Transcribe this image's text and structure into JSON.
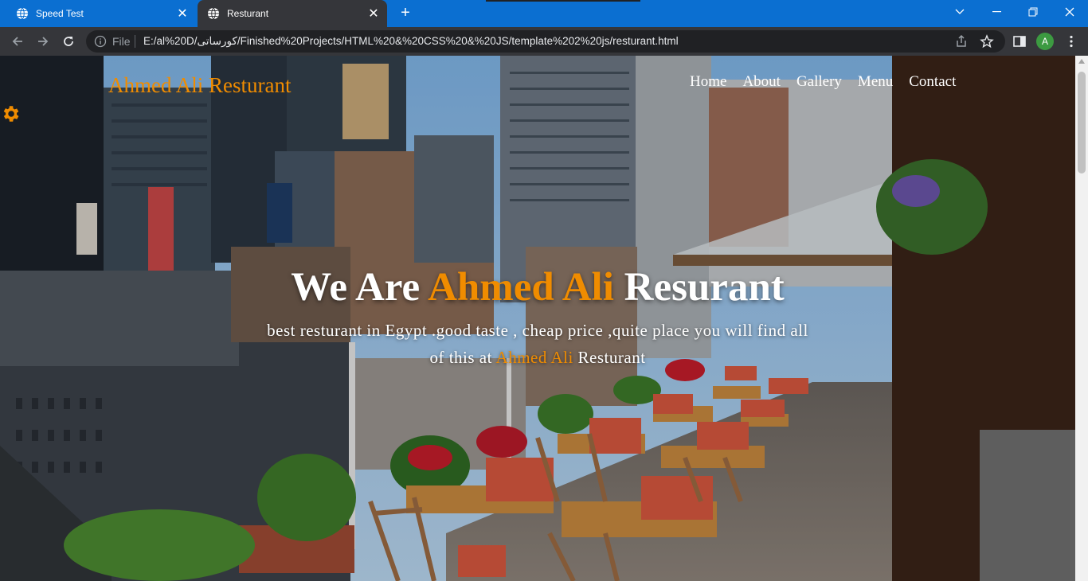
{
  "browser": {
    "tabs": [
      {
        "title": "Speed Test",
        "active": false
      },
      {
        "title": "Resturant",
        "active": true
      }
    ],
    "new_tab_label": "+",
    "window_controls": {
      "minimize": "—",
      "restore": "❐",
      "close": "✕"
    },
    "address": {
      "scheme_label": "File",
      "url": "E:/al%20D/کورساتی/Finished%20Projects/HTML%20&%20CSS%20&%20JS/template%202%20js/resturant.html"
    },
    "profile_initial": "A",
    "colors": {
      "tab_strip": "#0b6fd1",
      "toolbar": "#35363a",
      "omnibox": "#202124"
    }
  },
  "page": {
    "logo": "Ahmed Ali Resturant",
    "nav": [
      "Home",
      "About",
      "Gallery",
      "Menu",
      "Contact"
    ],
    "settings_icon": "gear-icon",
    "hero": {
      "title_before": "We Are ",
      "title_accent": "Ahmed Ali",
      "title_after": " Resurant",
      "subtitle_before": "best resturant in Egypt .good taste , cheap price ,quite place  you will find all of this at ",
      "subtitle_accent": "Ahmed Ali",
      "subtitle_after": " Resturant"
    },
    "colors": {
      "accent": "#f08c00",
      "text": "#ffffff"
    }
  }
}
